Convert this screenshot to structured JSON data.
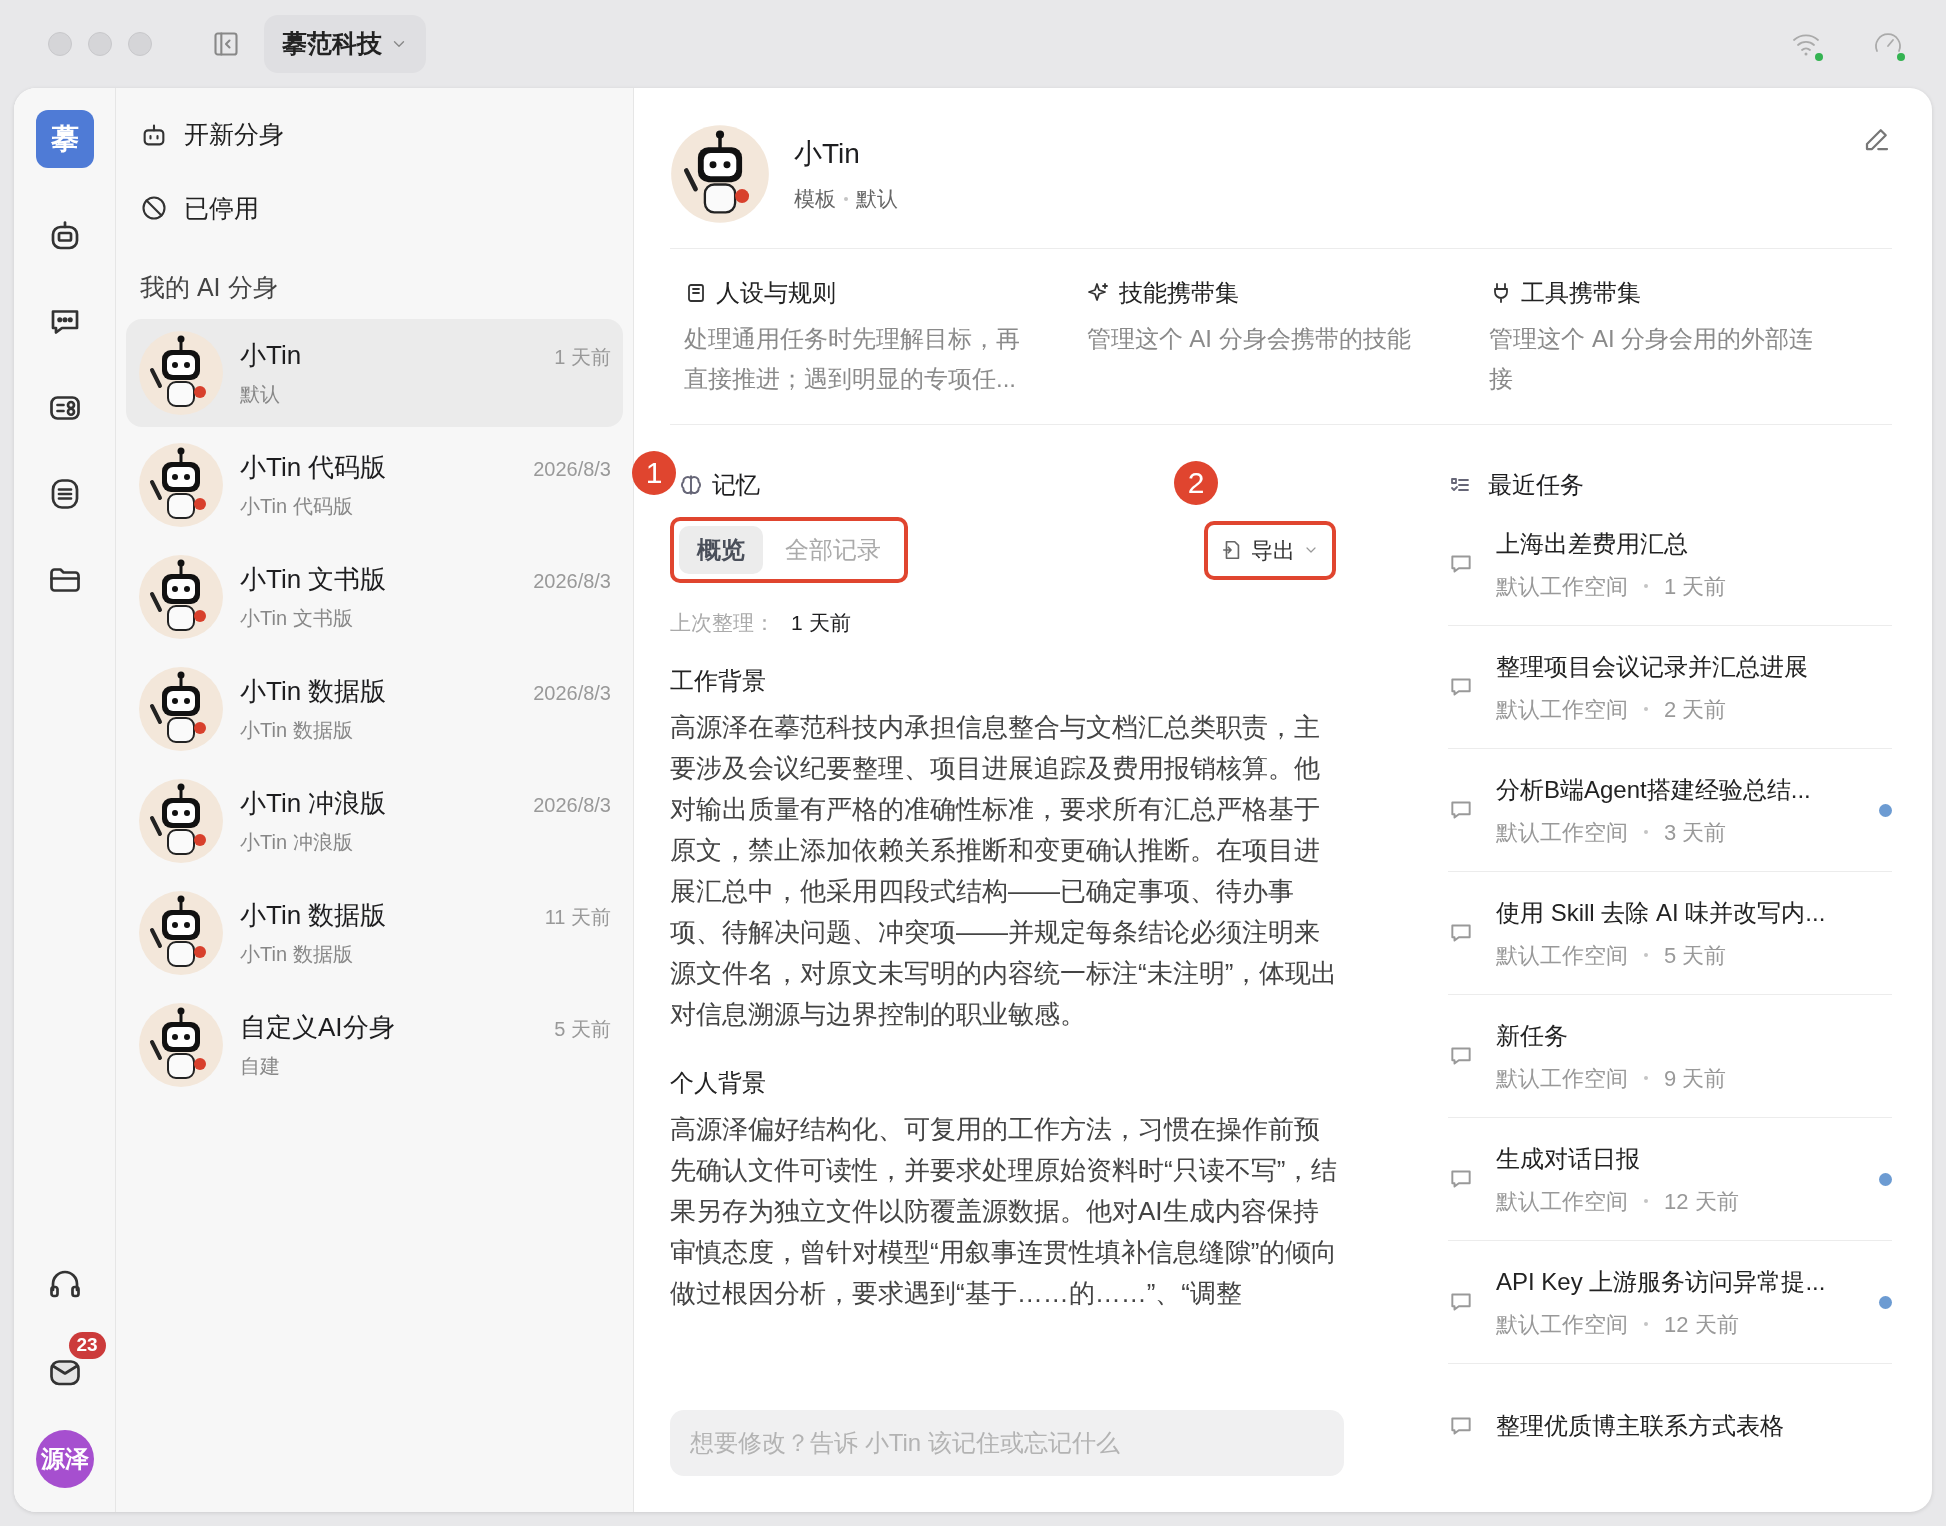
{
  "titlebar": {
    "workspace": "摹范科技"
  },
  "rail": {
    "logo": "摹",
    "mail_badge": "23",
    "user": "源泽"
  },
  "sidebar": {
    "actions": [
      {
        "kind": "new",
        "label": "开新分身"
      },
      {
        "kind": "disabled",
        "label": "已停用"
      }
    ],
    "section_title": "我的 AI 分身",
    "agents": [
      {
        "name": "小Tin",
        "subtitle": "默认",
        "time": "1 天前",
        "selected": true
      },
      {
        "name": "小Tin 代码版",
        "subtitle": "小Tin 代码版",
        "time": "2026/8/3",
        "selected": false
      },
      {
        "name": "小Tin 文书版",
        "subtitle": "小Tin 文书版",
        "time": "2026/8/3",
        "selected": false
      },
      {
        "name": "小Tin 数据版",
        "subtitle": "小Tin 数据版",
        "time": "2026/8/3",
        "selected": false
      },
      {
        "name": "小Tin 冲浪版",
        "subtitle": "小Tin 冲浪版",
        "time": "2026/8/3",
        "selected": false
      },
      {
        "name": "小Tin 数据版",
        "subtitle": "小Tin 数据版",
        "time": "11 天前",
        "selected": false
      },
      {
        "name": "自定义AI分身",
        "subtitle": "自建",
        "time": "5 天前",
        "selected": false
      }
    ]
  },
  "profile": {
    "name": "小Tin",
    "tags": [
      "模板",
      "默认"
    ]
  },
  "features": [
    {
      "kind": "persona",
      "title": "人设与规则",
      "description": "处理通用任务时先理解目标，再直接推进；遇到明显的专项任..."
    },
    {
      "kind": "skills",
      "title": "技能携带集",
      "description": "管理这个 AI 分身会携带的技能"
    },
    {
      "kind": "tools",
      "title": "工具携带集",
      "description": "管理这个 AI 分身会用的外部连接"
    }
  ],
  "memory": {
    "title": "记忆",
    "annotation": "1",
    "tabs": [
      {
        "label": "概览",
        "selected": true
      },
      {
        "label": "全部记录",
        "selected": false
      }
    ],
    "export": {
      "label": "导出",
      "annotation": "2"
    },
    "last_updated_label": "上次整理：",
    "last_updated": "1 天前",
    "sections": [
      {
        "heading": "工作背景",
        "body": "高源泽在摹范科技内承担信息整合与文档汇总类职责，主要涉及会议纪要整理、项目进展追踪及费用报销核算。他对输出质量有严格的准确性标准，要求所有汇总严格基于原文，禁止添加依赖关系推断和变更确认推断。在项目进展汇总中，他采用四段式结构——已确定事项、待办事项、待解决问题、冲突项——并规定每条结论必须注明来源文件名，对原文未写明的内容统一标注“未注明”，体现出对信息溯源与边界控制的职业敏感。"
      },
      {
        "heading": "个人背景",
        "body": "高源泽偏好结构化、可复用的工作方法，习惯在操作前预先确认文件可读性，并要求处理原始资料时“只读不写”，结果另存为独立文件以防覆盖源数据。他对AI生成内容保持审慎态度，曾针对模型“用叙事连贯性填补信息缝隙”的倾向做过根因分析，要求遇到“基于……的……”、“调整"
      }
    ],
    "input": {
      "placeholder": "想要修改？告诉 小Tin 该记住或忘记什么"
    }
  },
  "tasks": {
    "title": "最近任务",
    "items": [
      {
        "title": "上海出差费用汇总",
        "workspace": "默认工作空间",
        "time": "1 天前",
        "unread": false
      },
      {
        "title": "整理项目会议记录并汇总进展",
        "workspace": "默认工作空间",
        "time": "2 天前",
        "unread": false
      },
      {
        "title": "分析B端Agent搭建经验总结...",
        "workspace": "默认工作空间",
        "time": "3 天前",
        "unread": true
      },
      {
        "title": "使用 Skill 去除 AI 味并改写内...",
        "workspace": "默认工作空间",
        "time": "5 天前",
        "unread": false
      },
      {
        "title": "新任务",
        "workspace": "默认工作空间",
        "time": "9 天前",
        "unread": false
      },
      {
        "title": "生成对话日报",
        "workspace": "默认工作空间",
        "time": "12 天前",
        "unread": true
      },
      {
        "title": "API Key 上游服务访问异常提...",
        "workspace": "默认工作空间",
        "time": "12 天前",
        "unread": true
      },
      {
        "title": "整理优质博主联系方式表格",
        "unread": false
      }
    ]
  }
}
